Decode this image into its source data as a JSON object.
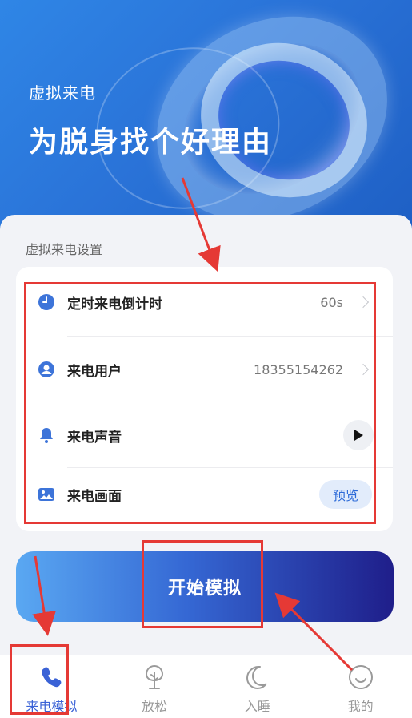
{
  "hero": {
    "subtitle": "虚拟来电",
    "title": "为脱身找个好理由"
  },
  "settings": {
    "section_label": "虚拟来电设置",
    "rows": [
      {
        "label": "定时来电倒计时",
        "value": "60s",
        "icon": "clock-icon"
      },
      {
        "label": "来电用户",
        "value": "18355154262",
        "icon": "user-icon"
      },
      {
        "label": "来电声音",
        "icon": "bell-icon",
        "action_icon": "play-icon"
      },
      {
        "label": "来电画面",
        "icon": "image-icon",
        "action_label": "预览"
      }
    ]
  },
  "start_button": {
    "label": "开始模拟"
  },
  "tabs": [
    {
      "label": "来电模拟",
      "icon": "phone-icon",
      "active": true
    },
    {
      "label": "放松",
      "icon": "tree-icon",
      "active": false
    },
    {
      "label": "入睡",
      "icon": "moon-icon",
      "active": false
    },
    {
      "label": "我的",
      "icon": "smile-icon",
      "active": false
    }
  ],
  "colors": {
    "accent": "#3a62d6",
    "annotation": "#e53935",
    "hero_start": "#2f86e6",
    "button_end": "#1f1e8a"
  }
}
